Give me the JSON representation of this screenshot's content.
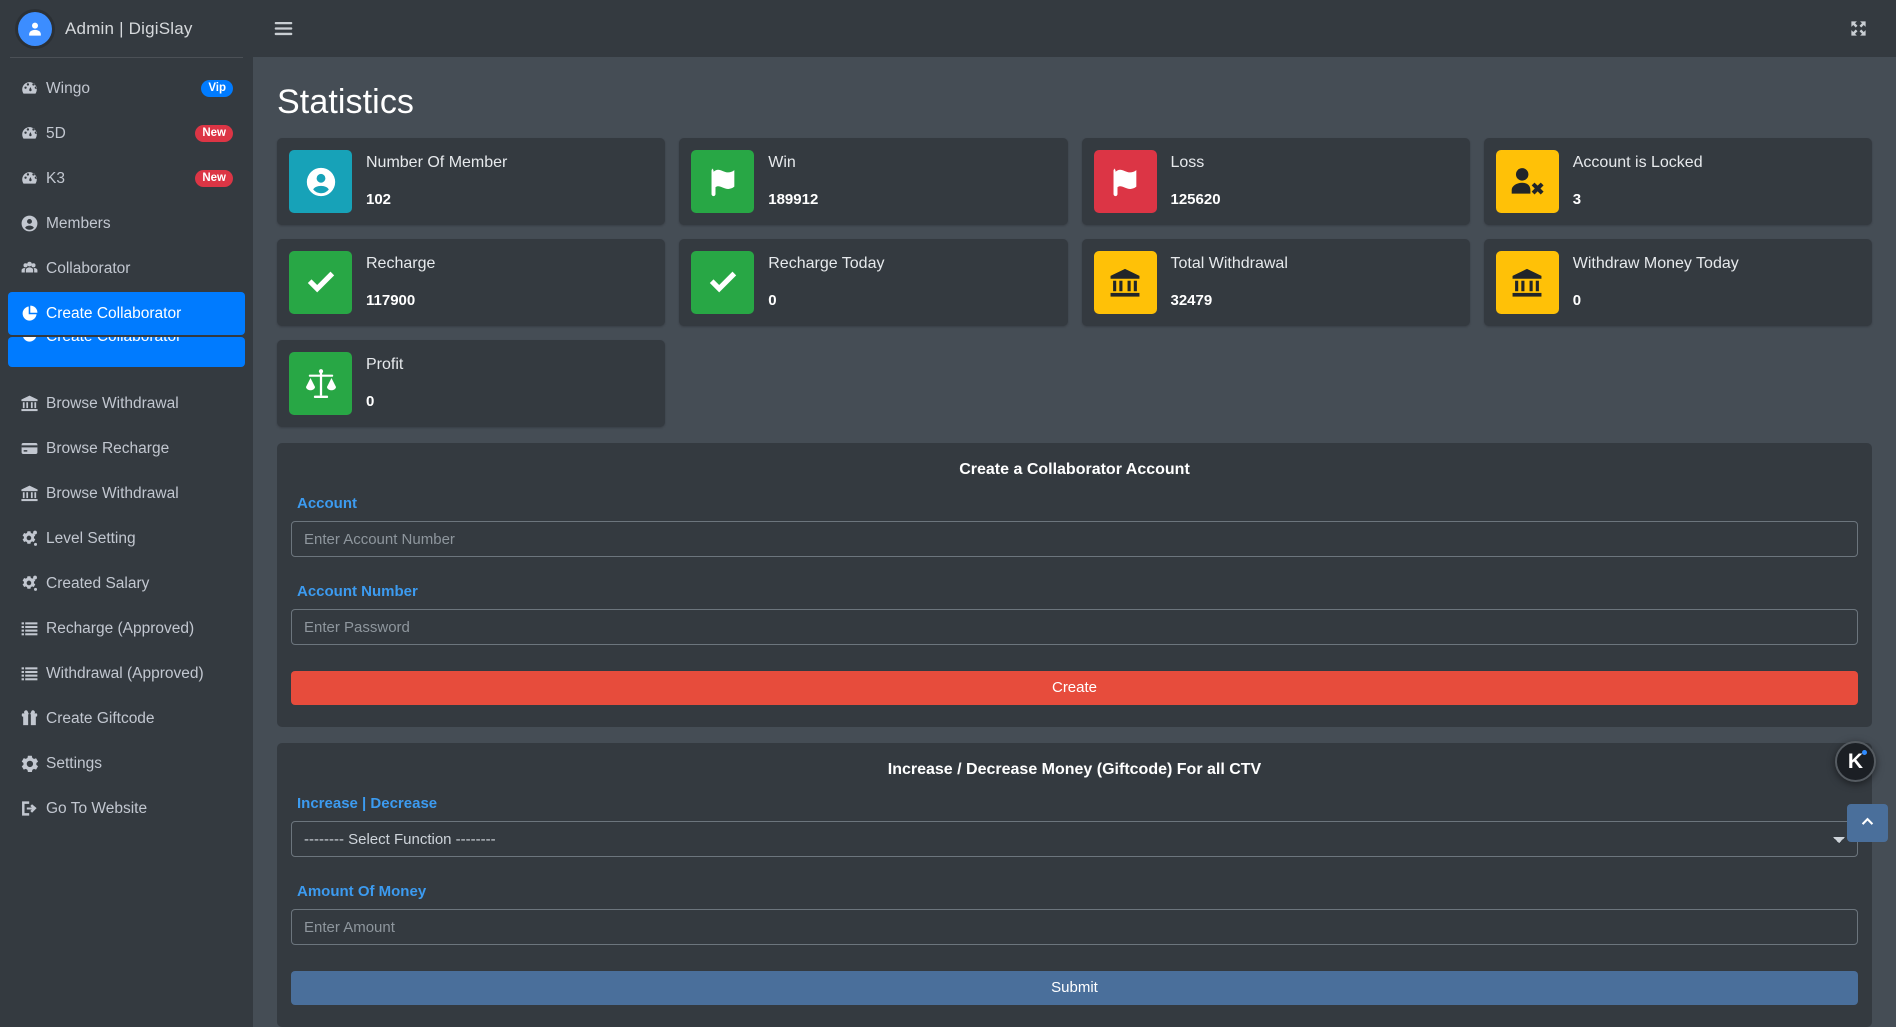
{
  "sidebar": {
    "brand": {
      "title": "Admin | DigiSlay",
      "avatar_icon": "user-circle-icon"
    },
    "items": [
      {
        "label": "Wingo",
        "icon": "gauge-icon",
        "badge": "Vip",
        "badge_type": "vip",
        "active": false
      },
      {
        "label": "5D",
        "icon": "gauge-icon",
        "badge": "New",
        "badge_type": "new",
        "active": false
      },
      {
        "label": "K3",
        "icon": "gauge-icon",
        "badge": "New",
        "badge_type": "new",
        "active": false
      },
      {
        "label": "Members",
        "icon": "user-circle-icon",
        "badge": "",
        "badge_type": "",
        "active": false
      },
      {
        "label": "Collaborator",
        "icon": "users-icon",
        "badge": "",
        "badge_type": "",
        "active": false
      },
      {
        "label": "Create Collaborator",
        "icon": "pie-chart-icon",
        "badge": "",
        "badge_type": "",
        "active": true
      },
      {
        "label": "Browse Recharge",
        "icon": "credit-card-icon",
        "badge": "",
        "badge_type": "",
        "active": false
      },
      {
        "label": "Browse Withdrawal",
        "icon": "bank-icon",
        "badge": "",
        "badge_type": "",
        "active": false
      },
      {
        "label": "Browse Recharge",
        "icon": "credit-card-icon",
        "badge": "",
        "badge_type": "",
        "active": false
      },
      {
        "label": "Browse Withdrawal",
        "icon": "bank-icon",
        "badge": "",
        "badge_type": "",
        "active": false
      },
      {
        "label": "Level Setting",
        "icon": "gears-icon",
        "badge": "",
        "badge_type": "",
        "active": false
      },
      {
        "label": "Created Salary",
        "icon": "gears-icon",
        "badge": "",
        "badge_type": "",
        "active": false
      },
      {
        "label": "Recharge (Approved)",
        "icon": "list-icon",
        "badge": "",
        "badge_type": "",
        "active": false
      },
      {
        "label": "Withdrawal (Approved)",
        "icon": "list-icon",
        "badge": "",
        "badge_type": "",
        "active": false
      },
      {
        "label": "Create Giftcode",
        "icon": "gift-icon",
        "badge": "",
        "badge_type": "",
        "active": false
      },
      {
        "label": "Settings",
        "icon": "gear-icon",
        "badge": "",
        "badge_type": "",
        "active": false
      },
      {
        "label": "Go To Website",
        "icon": "sign-out-icon",
        "badge": "",
        "badge_type": "",
        "active": false
      }
    ],
    "ghost_overlay_label": "Create Collaborator"
  },
  "topbar": {
    "menu_icon": "hamburger-icon",
    "fullscreen_icon": "expand-arrows-icon"
  },
  "page": {
    "title": "Statistics"
  },
  "cards": [
    {
      "label": "Number Of Member",
      "value": "102",
      "color": "#17a2b8",
      "icon": "user-circle-icon",
      "icon_color": "#ffffff"
    },
    {
      "label": "Win",
      "value": "189912",
      "color": "#28a745",
      "icon": "flag-icon",
      "icon_color": "#ffffff"
    },
    {
      "label": "Loss",
      "value": "125620",
      "color": "#dc3545",
      "icon": "flag-icon",
      "icon_color": "#ffffff"
    },
    {
      "label": "Account is Locked",
      "value": "3",
      "color": "#ffc107",
      "icon": "user-times-icon",
      "icon_color": "#212529"
    },
    {
      "label": "Recharge",
      "value": "117900",
      "color": "#28a745",
      "icon": "check-icon",
      "icon_color": "#ffffff"
    },
    {
      "label": "Recharge Today",
      "value": "0",
      "color": "#28a745",
      "icon": "check-icon",
      "icon_color": "#ffffff"
    },
    {
      "label": "Total Withdrawal",
      "value": "32479",
      "color": "#ffc107",
      "icon": "bank-icon",
      "icon_color": "#212529"
    },
    {
      "label": "Withdraw Money Today",
      "value": "0",
      "color": "#ffc107",
      "icon": "bank-icon",
      "icon_color": "#212529"
    },
    {
      "label": "Profit",
      "value": "0",
      "color": "#28a745",
      "icon": "scale-icon",
      "icon_color": "#ffffff"
    }
  ],
  "create_form": {
    "title": "Create a Collaborator Account",
    "account_label": "Account",
    "account_placeholder": "Enter Account Number",
    "account_value": "",
    "password_label": "Account Number",
    "password_placeholder": "Enter Password",
    "password_value": "",
    "submit_label": "Create"
  },
  "giftcode_form": {
    "title": "Increase / Decrease Money (Giftcode) For all CTV",
    "function_label": "Increase | Decrease",
    "function_selected": "-------- Select Function --------",
    "function_options": [
      "-------- Select Function --------"
    ],
    "amount_label": "Amount Of Money",
    "amount_placeholder": "Enter Amount",
    "amount_value": "",
    "submit_label": "Submit"
  },
  "floating": {
    "badge_letter": "K",
    "badge_icon": "k-logo-badge-icon",
    "scroll_top_icon": "chevron-up-icon"
  },
  "colors": {
    "accent_blue": "#007bff",
    "label_blue": "#3c9bf0",
    "sidebar_bg": "#343a40",
    "content_bg": "#454d55",
    "danger": "#e74c3c",
    "submit_blue": "#4a6f9b"
  }
}
